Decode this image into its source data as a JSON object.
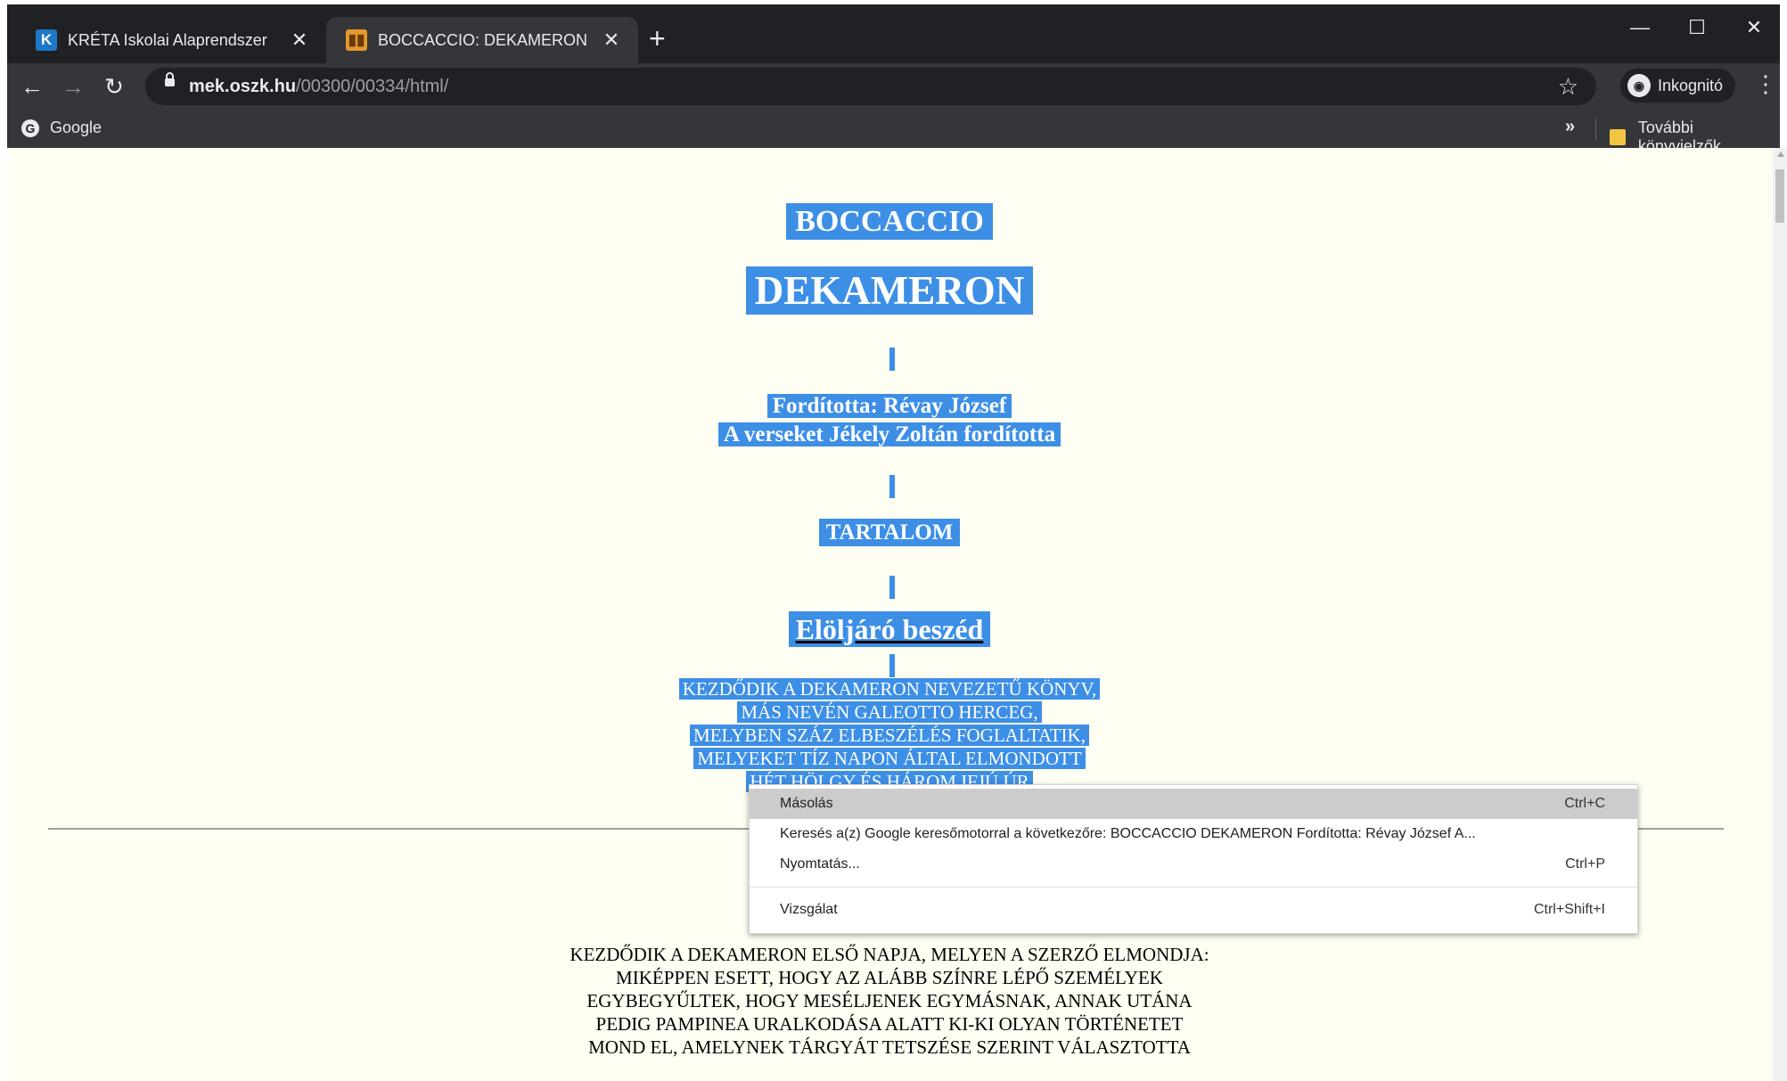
{
  "browser": {
    "tabs": [
      {
        "label": "KRÉTA Iskolai Alaprendszer",
        "favicon": "K",
        "active": false
      },
      {
        "label": "BOCCACCIO: DEKAMERON",
        "favicon": "book",
        "active": true
      }
    ],
    "new_tab": "+",
    "url": {
      "host": "mek.oszk.hu",
      "path": "/00300/00334/html/"
    },
    "incognito_label": "Inkognitó",
    "bookmarks": {
      "google": "Google",
      "more": "»",
      "other": "További könyvjelzők"
    }
  },
  "page": {
    "author": "BOCCACCIO",
    "title": "DEKAMERON",
    "translated_by": "Fordította: Révay József",
    "verses_by": "A verseket Jékely Zoltán fordította",
    "contents": "TARTALOM",
    "foreword_link": "Elöljáró beszéd",
    "intro_lines": [
      "KEZDŐDIK A DEKAMERON NEVEZETŰ KÖNYV,",
      "MÁS NEVÉN GALEOTTO HERCEG,",
      "MELYBEN SZÁZ ELBESZÉLÉS FOGLALTATIK,",
      "MELYEKET TÍZ NAPON ÁLTAL ELMONDOTT",
      "HÉT HÖLGY ÉS HÁROM IFJÚ ÚR"
    ],
    "first_day_lines": [
      "KEZDŐDIK A DEKAMERON ELSŐ NAPJA, MELYEN A SZERZŐ ELMONDJA:",
      "MIKÉPPEN ESETT, HOGY AZ ALÁBB SZÍNRE LÉPŐ SZEMÉLYEK",
      "EGYBEGYŰLTEK, HOGY MESÉLJENEK EGYMÁSNAK, ANNAK UTÁNA",
      "PEDIG PAMPINEA URALKODÁSA ALATT KI-KI OLYAN TÖRTÉNETET",
      "MOND EL, AMELYNEK TÁRGYÁT TETSZÉSE SZERINT VÁLASZTOTTA"
    ]
  },
  "context_menu": {
    "items": [
      {
        "label": "Másolás",
        "shortcut": "Ctrl+C",
        "highlighted": true
      },
      {
        "label": "Keresés a(z) Google keresőmotorral a következőre: BOCCACCIO DEKAMERON  Fordította: Révay József A...",
        "shortcut": ""
      },
      {
        "label": "Nyomtatás...",
        "shortcut": "Ctrl+P"
      },
      {
        "label": "Vizsgálat",
        "shortcut": "Ctrl+Shift+I"
      }
    ]
  },
  "colors": {
    "selection": "#3d8fe6",
    "page_background": "#fefef2",
    "chrome_dark": "#202124",
    "toolbar": "#35363a"
  }
}
